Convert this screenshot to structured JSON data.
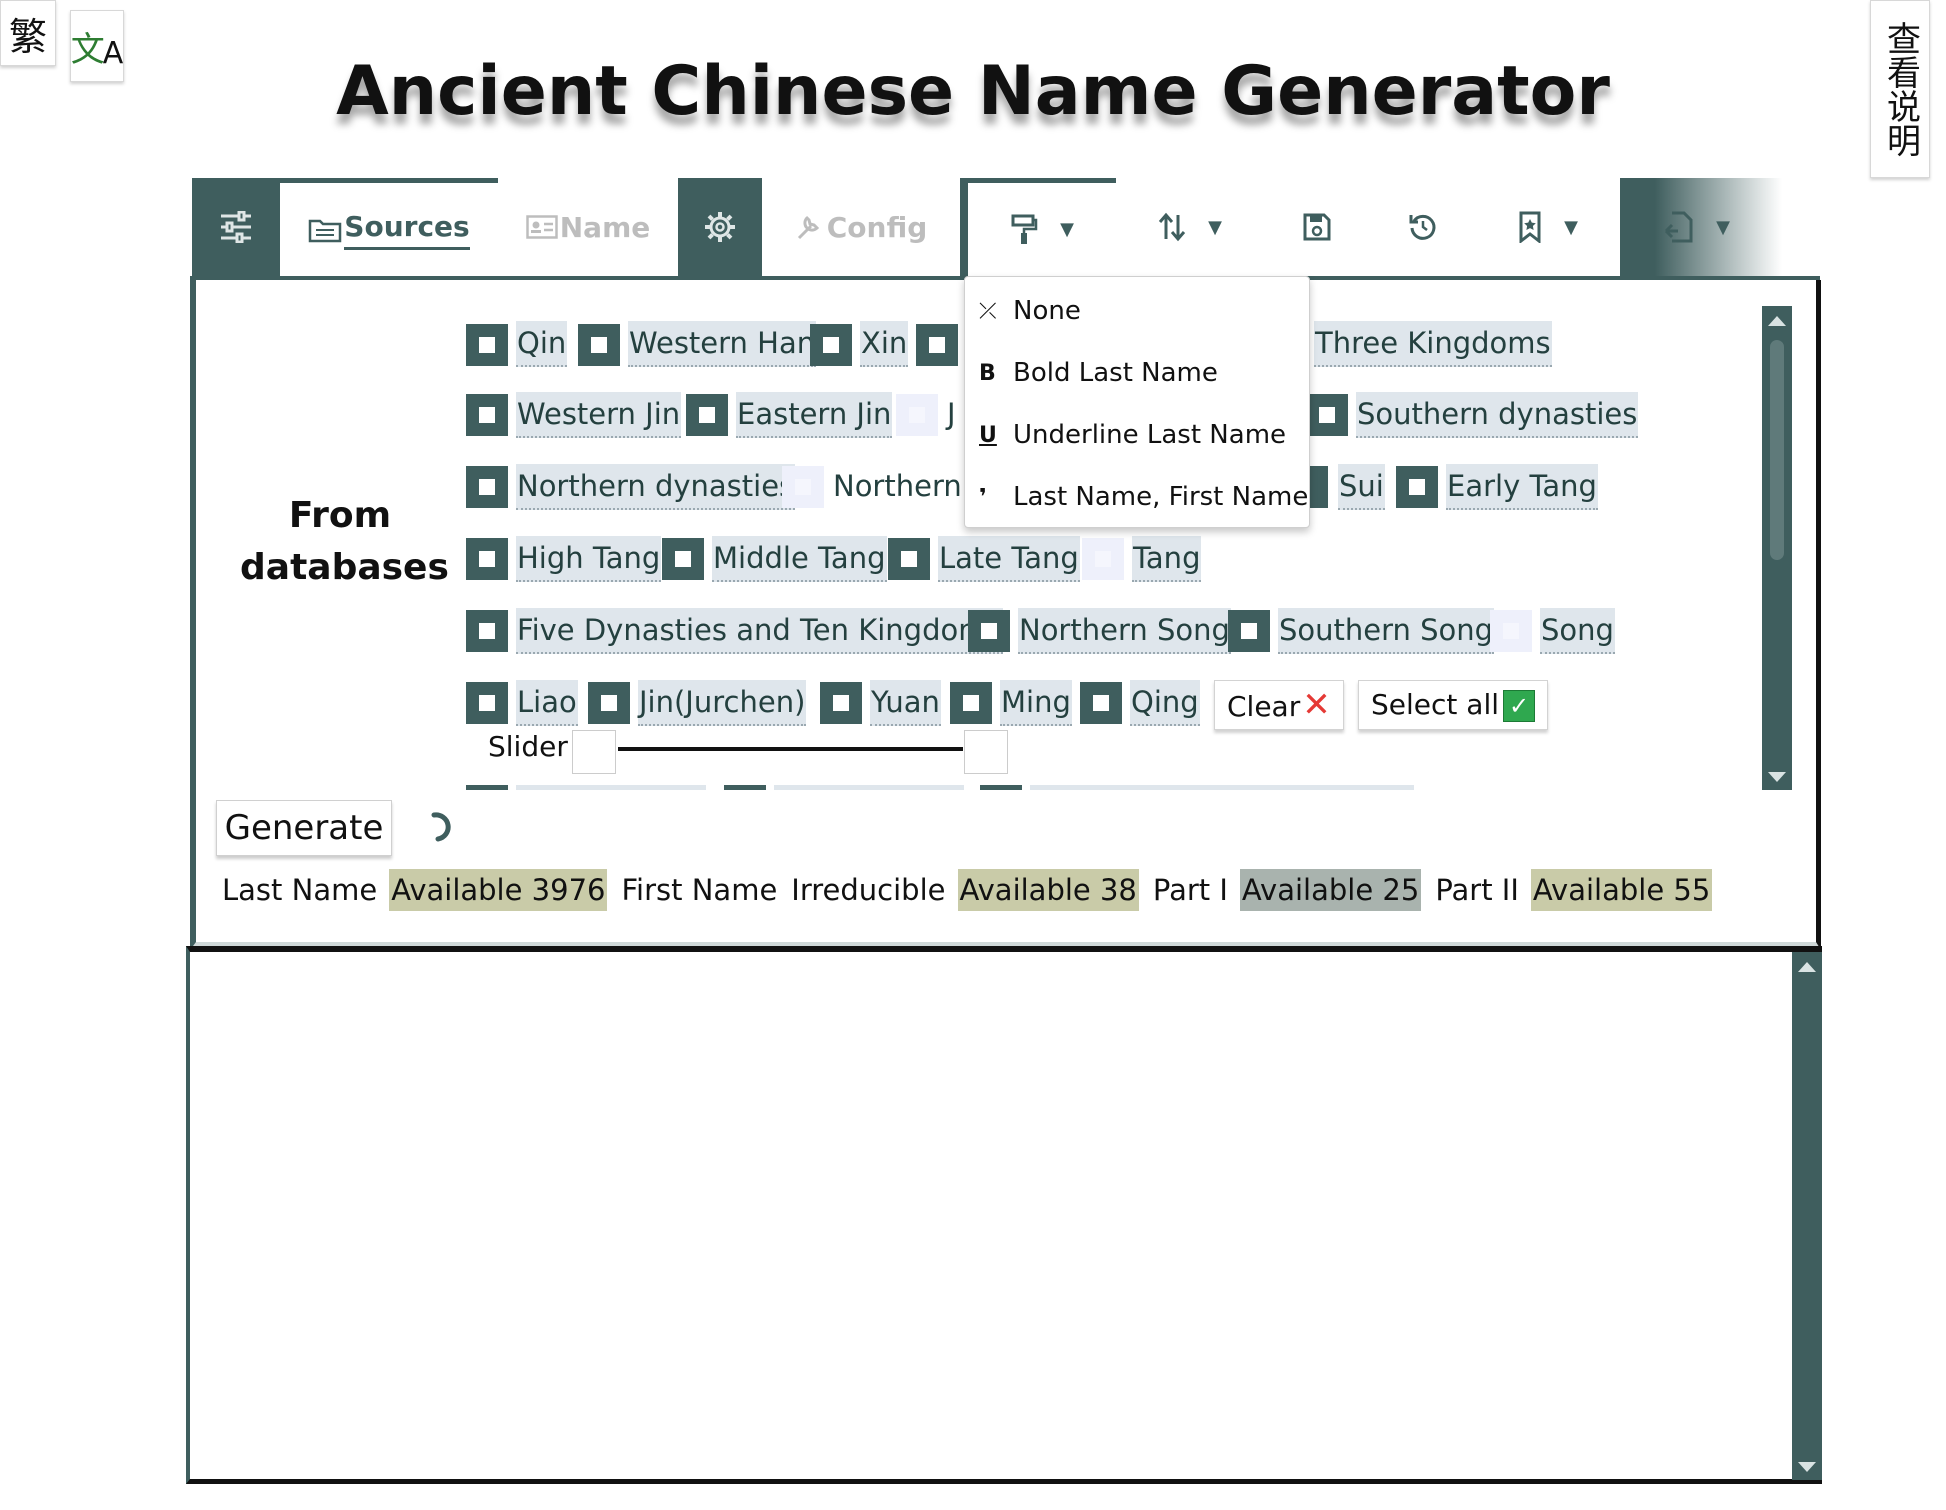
{
  "title": "Ancient Chinese Name Generator",
  "corner": {
    "traditional": "繁",
    "translate_main": "文",
    "translate_sub": "A",
    "help": "查看说明"
  },
  "tabs": {
    "sources": "Sources",
    "name": "Name",
    "config": "Config"
  },
  "sources": {
    "section_label": "From databases",
    "rows": [
      [
        "Qin",
        "Western Han",
        "Xin",
        "Three Kingdoms"
      ],
      [
        "Western Jin",
        "Eastern Jin",
        "J",
        "Southern dynasties"
      ],
      [
        "Northern dynasties",
        "Northern",
        "Sui",
        "Early Tang"
      ],
      [
        "High Tang",
        "Middle Tang",
        "Late Tang",
        "Tang"
      ],
      [
        "Five Dynasties and Ten Kingdoms",
        "Northern Song",
        "Southern Song",
        "Song"
      ],
      [
        "Liao",
        "Jin(Jurchen)",
        "Yuan",
        "Ming",
        "Qing"
      ]
    ],
    "clear_label": "Clear",
    "select_all_label": "Select all",
    "slider_label": "Slider"
  },
  "generate_label": "Generate",
  "stats": {
    "last_name_label": "Last Name",
    "last_name_available": "Available 3976",
    "first_name_label": "First Name",
    "irreducible_label": "Irreducible",
    "irreducible_available": "Available 38",
    "part1_label": "Part I",
    "part1_available": "Available 25",
    "part2_label": "Part II",
    "part2_available": "Available 55"
  },
  "format_menu": {
    "items": [
      "None",
      "Bold Last Name",
      "Underline Last Name",
      "Last Name, First Name"
    ],
    "icons": [
      "format-clear-icon",
      "bold-icon",
      "underline-icon",
      "comma-icon"
    ]
  },
  "colors": {
    "accent": "#3f5e5e",
    "label_bg": "#dfe6ec",
    "available_bg": "#c9cba8"
  }
}
